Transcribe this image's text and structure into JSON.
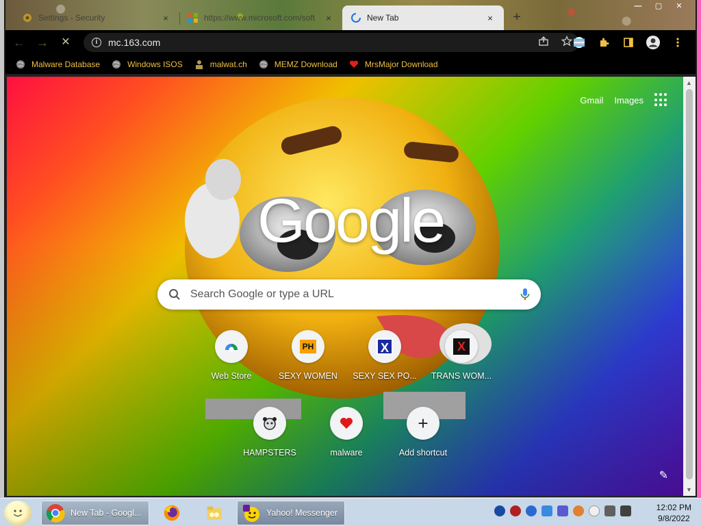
{
  "window": {
    "tabs": [
      {
        "title": "Settings - Security",
        "close": "×"
      },
      {
        "title": "https://www.microsoft.com/soft",
        "close": "×"
      },
      {
        "title": "New Tab",
        "close": "×"
      }
    ],
    "new_tab": "+",
    "controls": {
      "minimize": "—",
      "maximize": "▢",
      "close": "✕"
    }
  },
  "toolbar": {
    "url": "mc.163.com",
    "back": "←",
    "forward": "→",
    "stop": "✕"
  },
  "bookmarks": [
    {
      "label": "Malware Database",
      "icon": "globe-icon"
    },
    {
      "label": "Windows ISOS",
      "icon": "globe-icon"
    },
    {
      "label": "malwat.ch",
      "icon": "person-icon"
    },
    {
      "label": "MEMZ Download",
      "icon": "globe-icon"
    },
    {
      "label": "MrsMajor Download",
      "icon": "heart-icon"
    }
  ],
  "ntp": {
    "links": {
      "gmail": "Gmail",
      "images": "Images"
    },
    "logo": "Google",
    "search": {
      "placeholder": "Search Google or type a URL"
    },
    "shortcuts_row1": [
      {
        "label": "Web Store",
        "icon": "webstore-icon"
      },
      {
        "label": "SEXY WOMEN",
        "icon": "ph-icon",
        "glyph": "PH"
      },
      {
        "label": "SEXY SEX PO...",
        "icon": "x-icon",
        "glyph": "X"
      },
      {
        "label": "TRANS WOM...",
        "icon": "x-icon",
        "glyph": "X"
      }
    ],
    "shortcuts_row2": [
      {
        "label": "HAMPSTERS",
        "icon": "hamster-icon"
      },
      {
        "label": "malware",
        "icon": "heart-icon"
      },
      {
        "label": "Add shortcut",
        "icon": "plus-icon",
        "glyph": "+"
      }
    ],
    "customize": "✎"
  },
  "taskbar": {
    "items": [
      {
        "label": "New Tab - Googl...",
        "icon": "chrome-icon"
      },
      {
        "label": "",
        "icon": "firefox-icon"
      },
      {
        "label": "",
        "icon": "folder-icon"
      },
      {
        "label": "Yahoo! Messenger",
        "icon": "yahoo-messenger-icon"
      }
    ],
    "clock": {
      "time": "12:02 PM",
      "date": "9/8/2022"
    }
  },
  "colors": {
    "bookmark_text": "#f0c040",
    "toolbar_bg": "#000000",
    "ntp_text": "#ffffff"
  }
}
